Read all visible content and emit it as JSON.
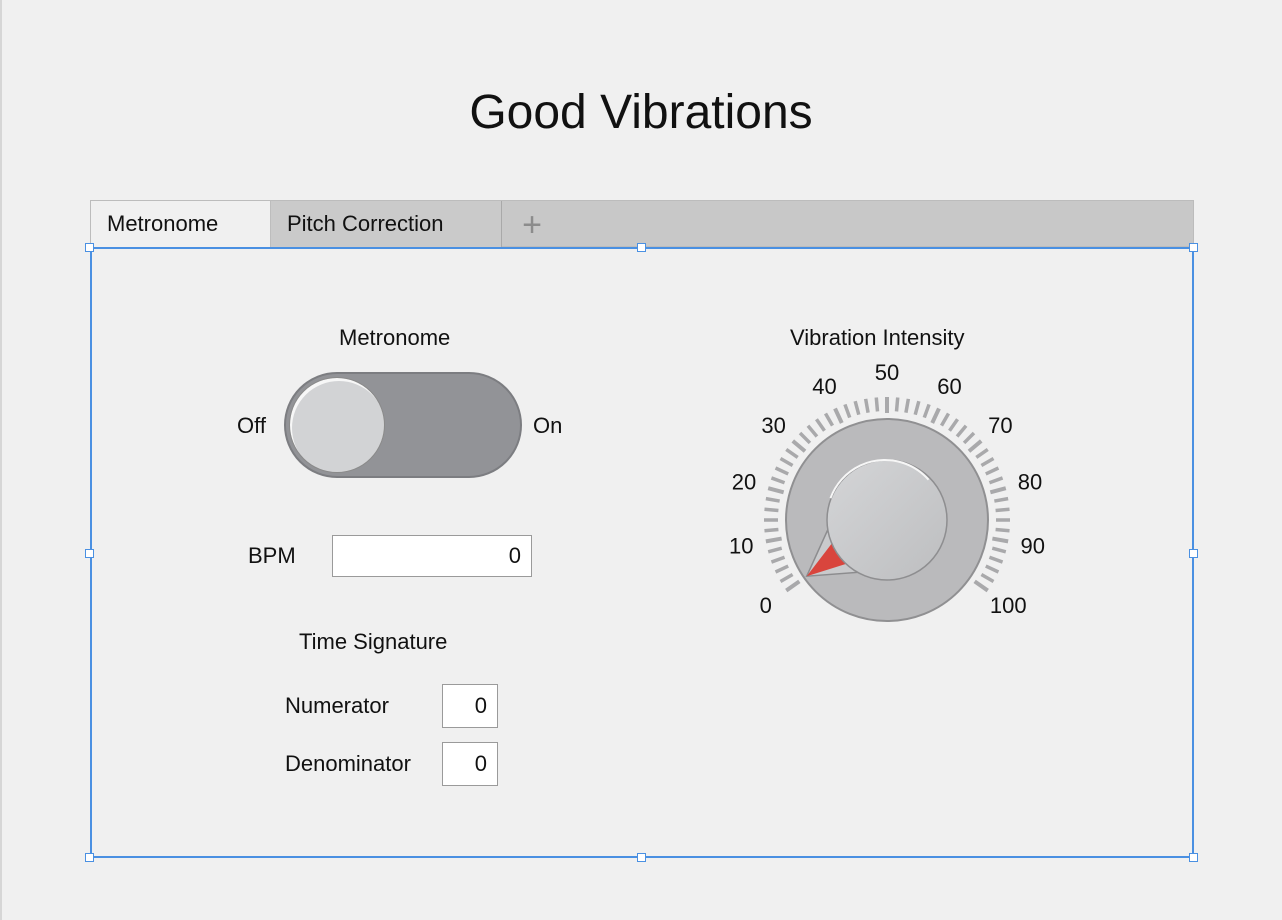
{
  "app": {
    "title": "Good Vibrations"
  },
  "tabs": [
    {
      "label": "Metronome",
      "active": true
    },
    {
      "label": "Pitch Correction",
      "active": false
    }
  ],
  "add_tab_glyph": "+",
  "metronome": {
    "label": "Metronome",
    "off_label": "Off",
    "on_label": "On",
    "state": "off"
  },
  "bpm": {
    "label": "BPM",
    "value": "0"
  },
  "time_signature": {
    "heading": "Time Signature",
    "numerator_label": "Numerator",
    "numerator_value": "0",
    "denominator_label": "Denominator",
    "denominator_value": "0"
  },
  "intensity": {
    "label": "Vibration Intensity",
    "scale_labels": [
      "0",
      "10",
      "20",
      "30",
      "40",
      "50",
      "60",
      "70",
      "80",
      "90",
      "100"
    ],
    "min": 0,
    "max": 100,
    "value": 0
  },
  "colors": {
    "selection": "#4a90e2",
    "needle": "#d9453d",
    "background": "#f0f0f0"
  },
  "icons": {
    "add_tab": "plus-icon"
  }
}
